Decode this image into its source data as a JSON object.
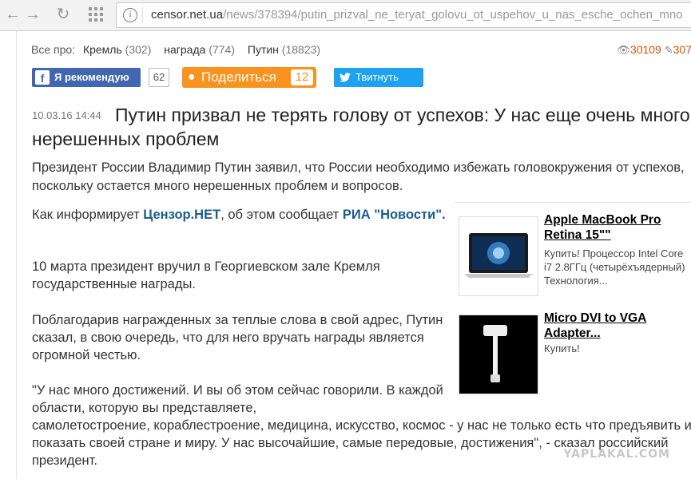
{
  "browser": {
    "url_host": "censor.net.ua",
    "url_path": "/news/378394/putin_prizval_ne_teryat_golovu_ot_uspehov_u_nas_esche_ochen_mno"
  },
  "tags": {
    "label": "Все про:",
    "items": [
      {
        "name": "Кремль",
        "count": "(302)"
      },
      {
        "name": "награда",
        "count": "(774)"
      },
      {
        "name": "Путин",
        "count": "(18823)"
      }
    ]
  },
  "stats": {
    "views": "30109",
    "comments": "307"
  },
  "share": {
    "fb_label": "Я рекомендую",
    "fb_count": "62",
    "ok_label": "Поделиться",
    "ok_count": "12",
    "tw_label": "Твитнуть"
  },
  "article": {
    "date": "10.03.16 14:44",
    "title": "Путин призвал не терять голову от успехов: У нас еще очень много нерешенных проблем",
    "lead": "Президент России Владимир Путин заявил, что России необходимо избежать головокружения от успехов, поскольку остается много нерешенных проблем и вопросов.",
    "p1_prefix": "Как информирует ",
    "p1_link1": "Цензор.НЕТ",
    "p1_mid": ", об этом сообщает ",
    "p1_link2": "РИА \"Новости\".",
    "p2": "10 марта президент вручил в Георгиевском зале Кремля государственные награды.",
    "p3": "Поблагодарив награжденных за теплые слова в свой адрес, Путин сказал, в свою очередь, что для него вручать награды является огромной честью.",
    "p4_a": "\"У нас много достижений. И вы об этом сейчас говорили. В каждой области, которую вы представляете,",
    "p4_b": "самолетостроение, кораблестроение, медицина, искусство, космос - у нас не только есть что предъявить и показать своей стране и миру. У нас высочайшие, самые передовые, достижения\", - сказал российский президент."
  },
  "ads": [
    {
      "title": "Apple MacBook Pro Retina 15\"\"",
      "desc": "Купить! Процессор Intel Core i7 2.8ГГц (четырёхъядерный) Технология..."
    },
    {
      "title": "Micro DVI to VGA Adapter...",
      "desc": "Купить!"
    }
  ],
  "watermark": "YAPLAKAL.COM"
}
